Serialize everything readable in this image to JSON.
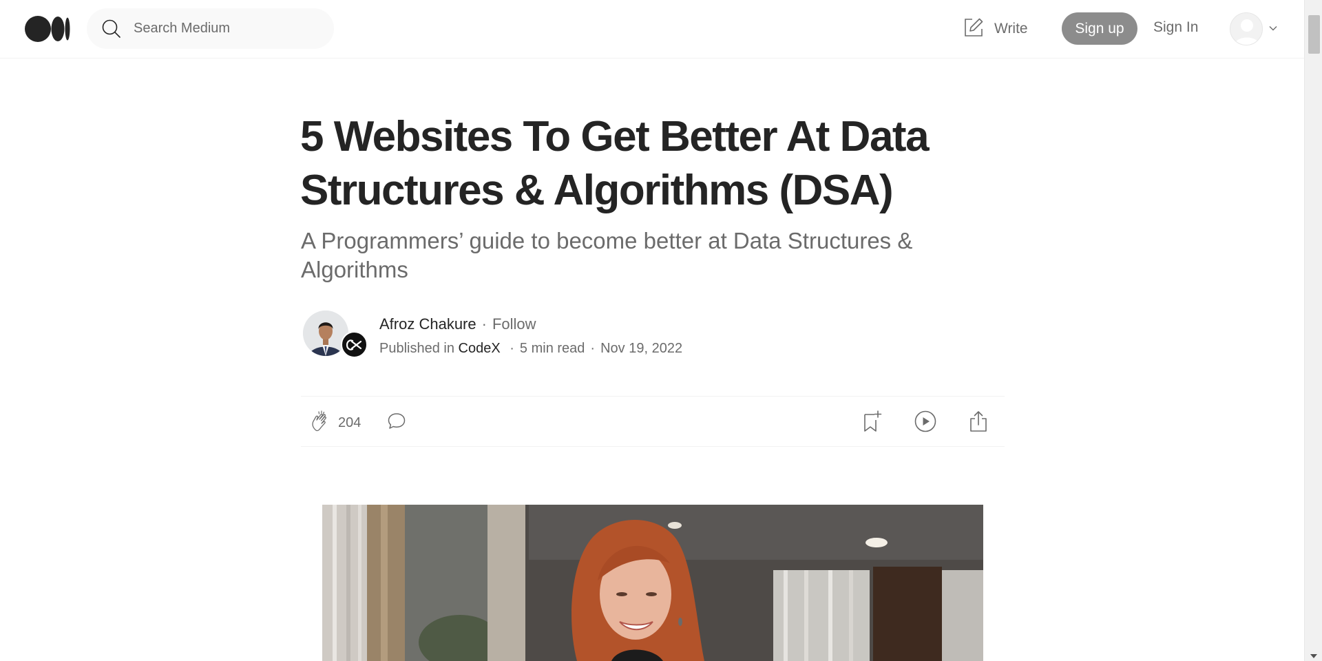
{
  "header": {
    "logo_name": "medium-logo",
    "search": {
      "placeholder": "Search Medium",
      "value": ""
    },
    "write_label": "Write",
    "signup_label": "Sign up",
    "signin_label": "Sign In"
  },
  "article": {
    "title": "5 Websites To Get Better At Data Structures & Algorithms (DSA)",
    "subtitle": "A Programmers’ guide to become better at Data Structures & Algorithms",
    "author": {
      "name": "Afroz Chakure",
      "follow_label": "Follow",
      "separator": "·"
    },
    "meta": {
      "published_in_label": "Published in",
      "publication": "CodeX",
      "read_time": "5 min read",
      "date": "Nov 19, 2022",
      "separator": "·"
    },
    "actions": {
      "clap_count": "204"
    }
  },
  "icons": {
    "search": "search-icon",
    "write": "write-icon",
    "chevron": "chevron-down-icon",
    "clap": "clap-icon",
    "comment": "comment-icon",
    "save": "bookmark-add-icon",
    "listen": "play-icon",
    "share": "share-icon"
  },
  "colors": {
    "text_primary": "#242424",
    "text_secondary": "#6b6b6b",
    "signup_bg": "#8c8c8c",
    "search_bg": "#f9f9f9",
    "divider": "#f2f2f2"
  }
}
